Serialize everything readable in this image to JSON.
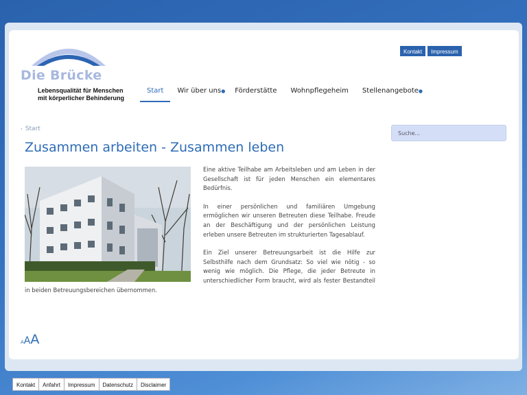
{
  "logo": {
    "name": "Die Brücke",
    "tagline_1": "Lebensqualität für Menschen",
    "tagline_2": "mit körperlicher Behinderung"
  },
  "top_links": [
    "Kontakt",
    "Impressum"
  ],
  "nav": {
    "items": [
      "Start",
      "Wir über uns",
      "Förderstätte",
      "Wohnpflegeheim",
      "Stellenangebote"
    ],
    "active": "Start"
  },
  "search": {
    "placeholder": "Suche..."
  },
  "breadcrumb": "Start",
  "page_title": "Zusammen arbeiten - Zusammen leben",
  "paragraphs": [
    "Eine aktive Teilhabe am Arbeitsleben und am Leben in der Gesellschaft ist für jeden Menschen ein elementares Bedürfnis.",
    "In einer persönlichen und familiären Umgebung ermöglichen wir unseren Betreuten diese Teilhabe. Freude an der Beschäftigung und der persönlichen Leistung erleben unsere Betreuten im strukturierten Tagesablauf.",
    "Ein Ziel unserer Betreuungsarbeit ist die Hilfe zur Selbsthilfe nach dem Grundsatz: So viel wie nötig - so wenig wie möglich. Die Pflege, die jeder Betreute in unterschiedlicher Form braucht, wird als fester Bestandteil in beiden Betreuungsbereichen übernommen."
  ],
  "font_size_controls": [
    "A",
    "A",
    "A"
  ],
  "footer_links": [
    "Kontakt",
    "Anfahrt",
    "Impressum",
    "Datenschutz",
    "Disclaimer"
  ],
  "colors": {
    "accent": "#2d6cb5",
    "logo_light": "#a7b8df",
    "button": "#2b62ad"
  }
}
